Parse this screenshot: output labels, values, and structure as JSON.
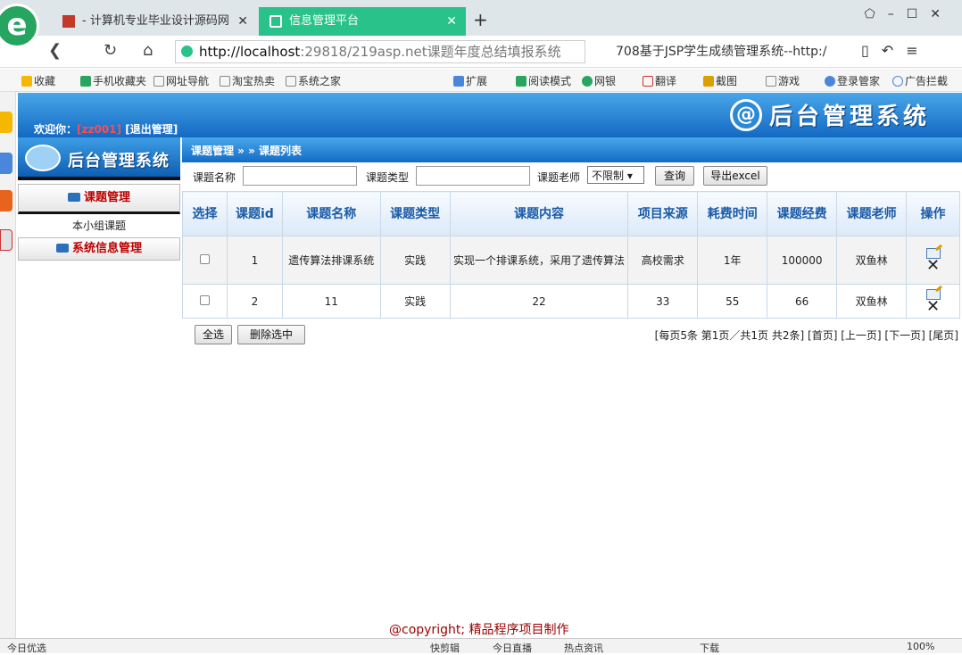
{
  "browser": {
    "tabs": [
      {
        "label": "- 计算机专业毕业设计源码网"
      },
      {
        "label": "信息管理平台"
      }
    ],
    "url_host": "http://localhost",
    "url_rest": ":29818/219asp.net课题年度总结填报系统",
    "search_text": "708基于JSP学生成绩管理系统--http:/",
    "bookmarks": [
      "收藏",
      "手机收藏夹",
      "网址导航",
      "淘宝热卖",
      "系统之家",
      "扩展",
      "阅读模式",
      "网银",
      "翻译",
      "截图",
      "游戏",
      "登录管家",
      "广告拦截"
    ],
    "status": {
      "left": "今日优选",
      "items": [
        "快剪辑",
        "今日直播",
        "热点资讯",
        "下载"
      ],
      "zoom": "100%"
    }
  },
  "header": {
    "welcome_label": "欢迎你：",
    "username": "[zz001]",
    "logout_label": "[退出管理]",
    "app_title": "后台管理系统",
    "logo_glyph": "@"
  },
  "sidebar": {
    "logo_text": "后台管理系统",
    "menu1_title": "课题管理",
    "menu1_items": [
      "本小组课题"
    ],
    "menu2_title": "系统信息管理"
  },
  "content": {
    "breadcrumb": "课题管理 » » 课题列表",
    "search": {
      "name_label": "课题名称",
      "name_value": "",
      "type_label": "课题类型",
      "type_value": "",
      "teacher_label": "课题老师",
      "teacher_selected": "不限制",
      "query_button": "查询",
      "export_button": "导出excel"
    },
    "table": {
      "headers": [
        "选择",
        "课题id",
        "课题名称",
        "课题类型",
        "课题内容",
        "项目来源",
        "耗费时间",
        "课题经费",
        "课题老师",
        "操作"
      ],
      "rows": [
        {
          "id": "1",
          "name": "遗传算法排课系统",
          "type": "实践",
          "content": "实现一个排课系统，采用了遗传算法",
          "source": "高校需求",
          "time": "1年",
          "fund": "100000",
          "teacher": "双鱼林"
        },
        {
          "id": "2",
          "name": "11",
          "type": "实践",
          "content": "22",
          "source": "33",
          "time": "55",
          "fund": "66",
          "teacher": "双鱼林"
        }
      ]
    },
    "select_all_button": "全选",
    "delete_selected_button": "删除选中",
    "pager": {
      "summary": "[每页5条 第1页／共1页 共2条]",
      "first": "[首页]",
      "prev": "[上一页]",
      "next": "[下一页]",
      "last": "[尾页]"
    },
    "copyright": "@copyright; 精品程序项目制作"
  }
}
